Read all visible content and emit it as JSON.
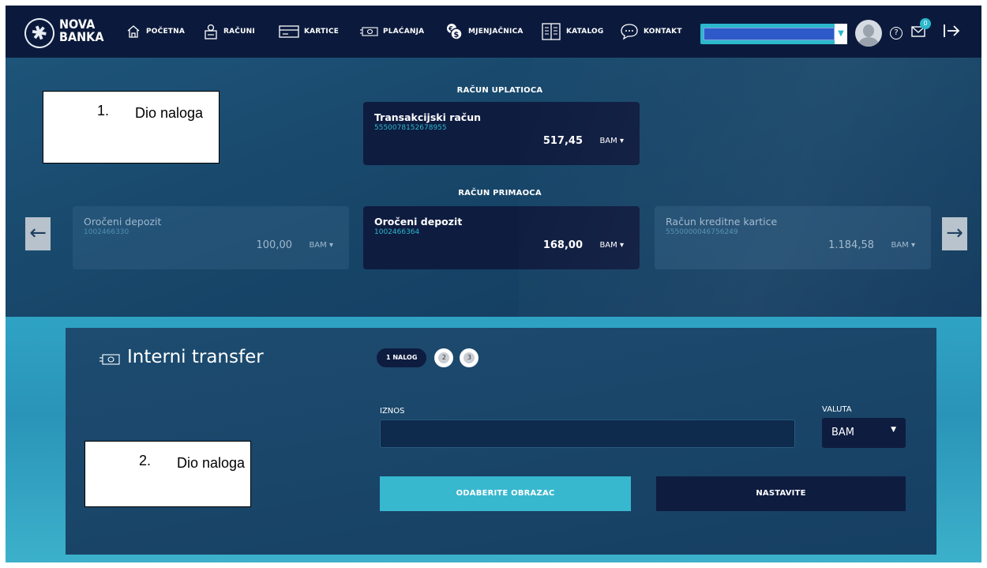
{
  "brand": {
    "line1": "NOVA",
    "line2": "BANKA"
  },
  "nav": {
    "items": [
      {
        "label": "POČETNA",
        "icon": "home-icon"
      },
      {
        "label": "RAČUNI",
        "icon": "accounts-icon"
      },
      {
        "label": "KARTICE",
        "icon": "card-icon"
      },
      {
        "label": "PLAĆANJA",
        "icon": "payments-icon"
      },
      {
        "label": "MJENJAČNICA",
        "icon": "exchange-icon"
      },
      {
        "label": "KATALOG",
        "icon": "catalog-icon"
      },
      {
        "label": "KONTAKT",
        "icon": "chat-icon"
      }
    ],
    "notifications_count": "0",
    "help_symbol": "?"
  },
  "payer": {
    "heading": "RAČUN UPLATIOCA",
    "card": {
      "title": "Transakcijski račun",
      "number": "5550078152678955",
      "amount": "517,45",
      "currency": "BAM"
    }
  },
  "recipient": {
    "heading": "RAČUN PRIMAOCA",
    "cards": [
      {
        "title": "Oročeni depozit",
        "number": "1002466330",
        "amount": "100,00",
        "currency": "BAM"
      },
      {
        "title": "Oročeni depozit",
        "number": "1002466364",
        "amount": "168,00",
        "currency": "BAM"
      },
      {
        "title": "Račun kreditne kartice",
        "number": "5550000046756249",
        "amount": "1.184,58",
        "currency": "BAM"
      }
    ],
    "prev_symbol": "←",
    "next_symbol": "→"
  },
  "annotations": [
    {
      "num": "1.",
      "text": "Dio naloga"
    },
    {
      "num": "2.",
      "text": "Dio naloga"
    }
  ],
  "form": {
    "title": "Interni transfer",
    "steps": {
      "active": "1 NALOG",
      "second": "2",
      "third": "3"
    },
    "amount_label": "IZNOS",
    "amount_value": "",
    "currency_label": "VALUTA",
    "currency_value": "BAM",
    "template_button": "ODABERITE OBRAZAC",
    "continue_button": "NASTAVITE"
  },
  "colors": {
    "nav_bg": "#0b1a3c",
    "accent": "#2bb8cc",
    "card_active": "#0e1c40",
    "panel": "#1d4c70"
  }
}
